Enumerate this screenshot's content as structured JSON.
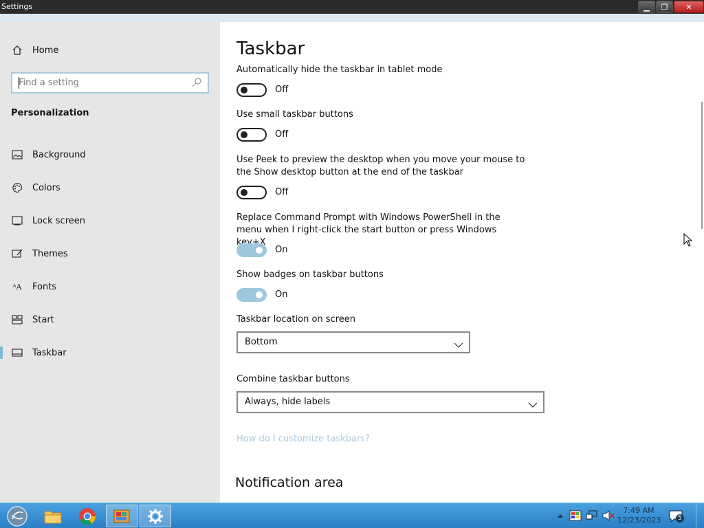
{
  "window": {
    "title": "Settings",
    "minimize": "▁",
    "maximize": "❐",
    "close": "✕"
  },
  "sidebar": {
    "home_label": "Home",
    "search_placeholder": "Find a setting",
    "section_title": "Personalization",
    "items": [
      {
        "label": "Background",
        "icon": "picture-icon"
      },
      {
        "label": "Colors",
        "icon": "palette-icon"
      },
      {
        "label": "Lock screen",
        "icon": "lock-screen-icon"
      },
      {
        "label": "Themes",
        "icon": "themes-icon"
      },
      {
        "label": "Fonts",
        "icon": "fonts-icon"
      },
      {
        "label": "Start",
        "icon": "start-icon"
      },
      {
        "label": "Taskbar",
        "icon": "taskbar-icon",
        "selected": true
      }
    ]
  },
  "main": {
    "title": "Taskbar",
    "settings": [
      {
        "label": "Automatically hide the taskbar in tablet mode",
        "state": "Off"
      },
      {
        "label": "Use small taskbar buttons",
        "state": "Off"
      },
      {
        "label": "Use Peek to preview the desktop when you move your mouse to the Show desktop button at the end of the taskbar",
        "state": "Off"
      },
      {
        "label": "Replace Command Prompt with Windows PowerShell in the menu when I right-click the start button or press Windows key+X",
        "state": "On"
      },
      {
        "label": "Show badges on taskbar buttons",
        "state": "On"
      }
    ],
    "location_label": "Taskbar location on screen",
    "location_value": "Bottom",
    "combine_label": "Combine taskbar buttons",
    "combine_value": "Always, hide labels",
    "help_link": "How do I customize taskbars?",
    "notification_heading": "Notification area"
  },
  "taskbar": {
    "time": "7:49 AM",
    "date": "12/23/2023",
    "notification_count": "5",
    "apps": [
      "start-orb",
      "file-explorer",
      "chrome",
      "file-manager",
      "settings"
    ]
  },
  "colors": {
    "accent": "#7fb9d9",
    "toggle_on": "#9ec8de",
    "taskbar": "#3a8fd3"
  }
}
